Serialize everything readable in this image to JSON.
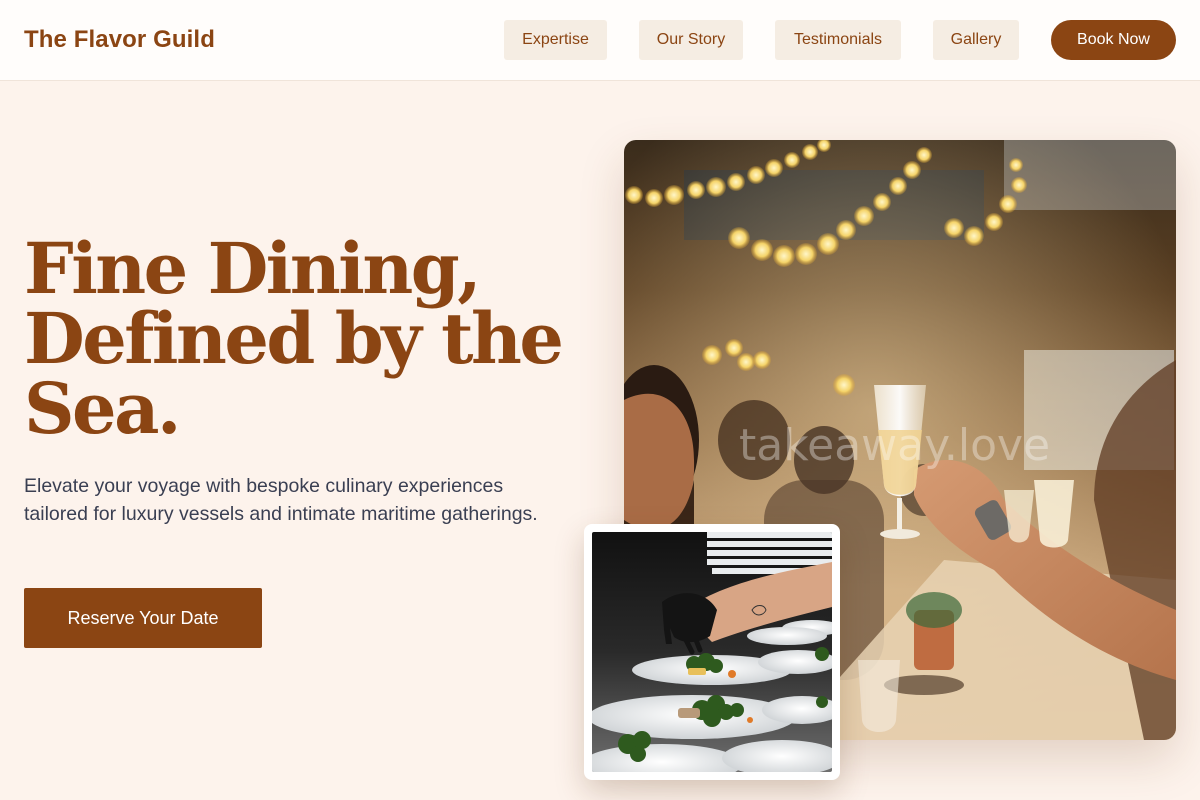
{
  "header": {
    "brand": "The Flavor Guild",
    "nav": [
      "Expertise",
      "Our Story",
      "Testimonials",
      "Gallery"
    ],
    "cta": "Book Now"
  },
  "hero": {
    "title_lines": [
      "Fine Dining,",
      "Defined by the",
      "Sea."
    ],
    "subtitle": "Elevate your voyage with bespoke culinary experiences tailored for luxury vessels and intimate maritime gatherings.",
    "cta": "Reserve Your Date"
  },
  "images": {
    "main_watermark": "takeaway.love"
  },
  "colors": {
    "brand": "#8b4513",
    "background": "#fdf3ec",
    "nav_button": "#f5ede3",
    "body_text": "#3a3f52"
  }
}
